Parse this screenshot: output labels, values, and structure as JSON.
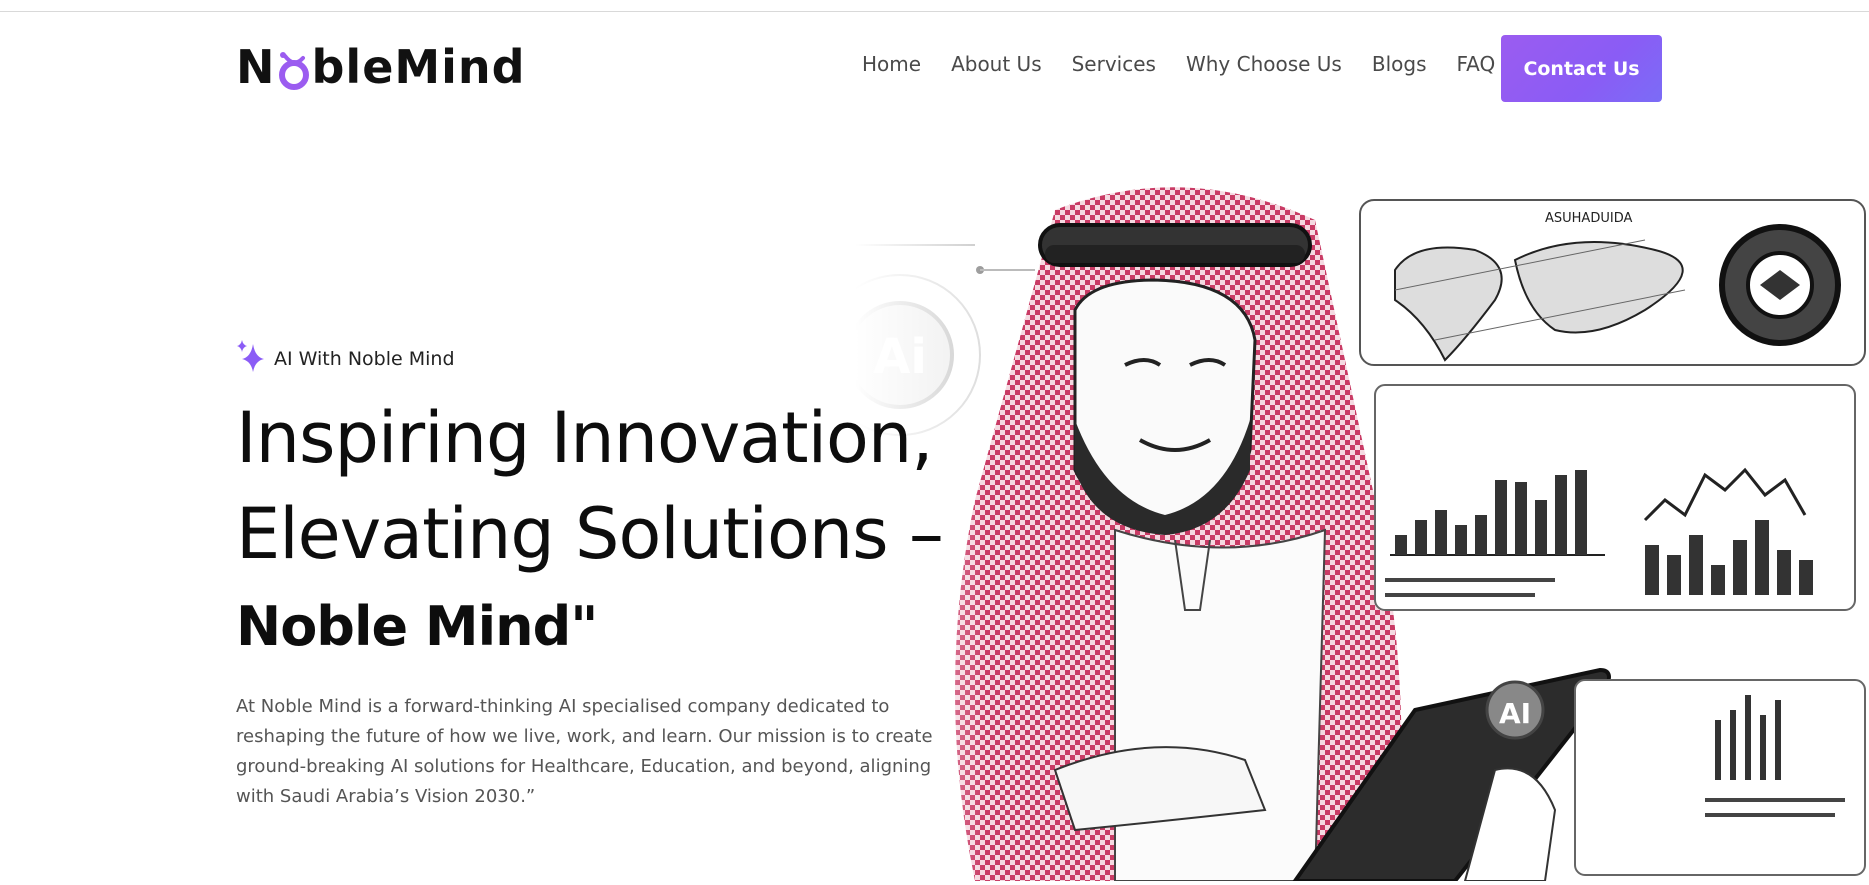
{
  "brand": {
    "logo_prefix": "N",
    "logo_suffix": "bleMind",
    "accent": "#9b5cf0"
  },
  "nav": {
    "items": [
      {
        "label": "Home"
      },
      {
        "label": "About Us"
      },
      {
        "label": "Services"
      },
      {
        "label": "Why Choose Us"
      },
      {
        "label": "Blogs"
      },
      {
        "label": "FAQ"
      }
    ],
    "cta_label": "Contact Us"
  },
  "hero": {
    "tag_icon": "sparkle-icon",
    "tag_text": "AI With Noble Mind",
    "title_line1": "Inspiring Innovation,",
    "title_line2": "Elevating Solutions –",
    "subtitle": "Noble Mind\"",
    "description": "At Noble Mind is a forward-thinking AI specialised company dedicated to reshaping the future of how we live, work, and learn. Our mission is to create ground-breaking AI solutions for Healthcare, Education, and beyond, aligning with Saudi Arabia’s Vision 2030.”",
    "illustration": {
      "panel_label": "ASUHADUIDA",
      "badge_text": "Ai",
      "gear_badge_text": "AI",
      "keffiyeh_color": "#c0184a"
    }
  }
}
